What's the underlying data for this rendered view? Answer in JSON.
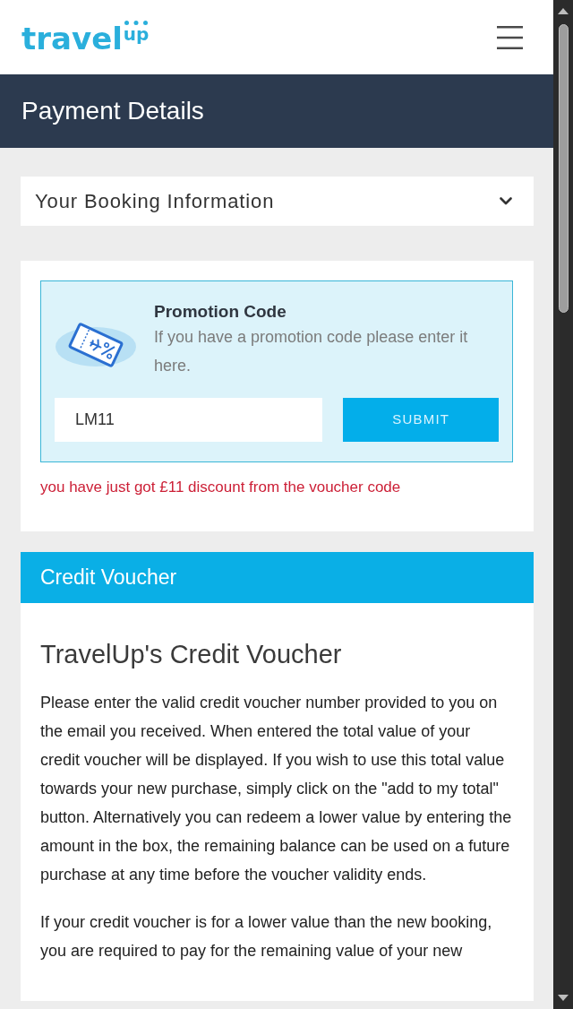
{
  "header": {
    "logo": {
      "word": "travel",
      "superscript": "up"
    }
  },
  "page_title": "Payment Details",
  "booking_info": {
    "label": "Your Booking Information",
    "expanded": false
  },
  "promotion": {
    "title": "Promotion Code",
    "description": "If you have a promotion code please enter it here.",
    "code_field": {
      "value": "LM11"
    },
    "submit_button": "SUBMIT",
    "message": "you have just got £11 discount from the voucher code"
  },
  "credit_voucher": {
    "header": "Credit Voucher",
    "title": "TravelUp's Credit Voucher",
    "paragraphs": [
      "Please enter the valid credit voucher number provided to you on the email you received. When entered the total value of your credit voucher will be displayed. If you wish to use this total value towards your new purchase, simply click on the \"add to my total\" button. Alternatively you can redeem a lower value by entering the amount in the box, the remaining balance can be used on a future purchase at any time before the voucher validity ends.",
      "If your credit voucher is for a lower value than the new booking, you are required to pay for the remaining value of your new"
    ]
  }
}
